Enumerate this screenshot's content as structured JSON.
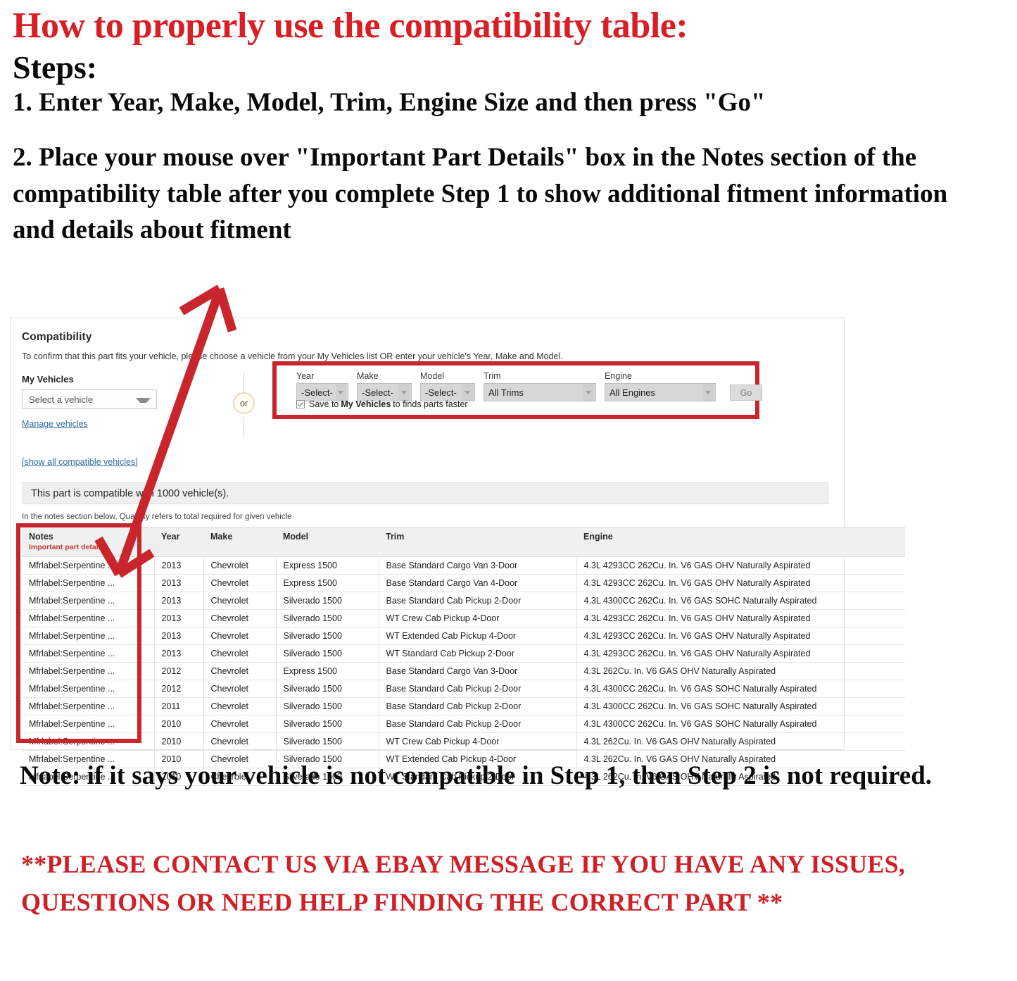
{
  "headline": {
    "title": "How to properly use the compatibility table:",
    "steps_label": "Steps:",
    "step1": "1. Enter Year, Make, Model, Trim, Engine Size and then press \"Go\"",
    "step2": "2. Place your mouse over \"Important Part Details\" box in the Notes section of the compatibility table after you complete Step 1 to show additional fitment information and details about fitment"
  },
  "footer": {
    "note": "Note: if it says your vehicle is not compatible in Step 1, then Step 2 is not required.",
    "contact": "**PLEASE CONTACT US VIA EBAY MESSAGE IF YOU HAVE ANY ISSUES, QUESTIONS OR NEED HELP FINDING THE CORRECT PART **"
  },
  "colors": {
    "red_accent": "#d81f26",
    "annotation_red": "#c8252c",
    "link_blue": "#2d6ca3",
    "important_red": "#c0392b"
  },
  "panel": {
    "title": "Compatibility",
    "subtitle": "To confirm that this part fits your vehicle, please choose a vehicle from your My Vehicles list OR enter your vehicle's Year, Make and Model.",
    "my_vehicles": {
      "label": "My Vehicles",
      "select_value": "Select a vehicle",
      "manage_link": "Manage vehicles"
    },
    "or_label": "or",
    "picker": {
      "fields": [
        {
          "label": "Year",
          "value": "-Select-"
        },
        {
          "label": "Make",
          "value": "-Select-"
        },
        {
          "label": "Model",
          "value": "-Select-"
        },
        {
          "label": "Trim",
          "value": "All Trims"
        },
        {
          "label": "Engine",
          "value": "All Engines"
        }
      ],
      "go_label": "Go",
      "save_prefix": "Save to ",
      "save_bold": "My Vehicles",
      "save_suffix": " to finds parts faster",
      "checkbox_checked": true
    },
    "show_all_link": "[show all compatible vehicles]",
    "compat_banner": "This part is compatible with 1000 vehicle(s).",
    "qty_note": "In the notes section below, Quantity refers to total required for given vehicle",
    "table": {
      "headers": {
        "notes": "Notes",
        "notes_sub": "Important part details",
        "year": "Year",
        "make": "Make",
        "model": "Model",
        "trim": "Trim",
        "engine": "Engine"
      },
      "rows": [
        {
          "notes": "Mfrlabel:Serpentine ...",
          "year": "2013",
          "make": "Chevrolet",
          "model": "Express 1500",
          "trim": "Base Standard Cargo Van 3-Door",
          "engine": "4.3L 4293CC 262Cu. In. V6 GAS OHV Naturally Aspirated"
        },
        {
          "notes": "Mfrlabel:Serpentine ...",
          "year": "2013",
          "make": "Chevrolet",
          "model": "Express 1500",
          "trim": "Base Standard Cargo Van 4-Door",
          "engine": "4.3L 4293CC 262Cu. In. V6 GAS OHV Naturally Aspirated"
        },
        {
          "notes": "Mfrlabel:Serpentine ...",
          "year": "2013",
          "make": "Chevrolet",
          "model": "Silverado 1500",
          "trim": "Base Standard Cab Pickup 2-Door",
          "engine": "4.3L 4300CC 262Cu. In. V6 GAS SOHC Naturally Aspirated"
        },
        {
          "notes": "Mfrlabel:Serpentine ...",
          "year": "2013",
          "make": "Chevrolet",
          "model": "Silverado 1500",
          "trim": "WT Crew Cab Pickup 4-Door",
          "engine": "4.3L 4293CC 262Cu. In. V6 GAS OHV Naturally Aspirated"
        },
        {
          "notes": "Mfrlabel:Serpentine ...",
          "year": "2013",
          "make": "Chevrolet",
          "model": "Silverado 1500",
          "trim": "WT Extended Cab Pickup 4-Door",
          "engine": "4.3L 4293CC 262Cu. In. V6 GAS OHV Naturally Aspirated"
        },
        {
          "notes": "Mfrlabel:Serpentine ...",
          "year": "2013",
          "make": "Chevrolet",
          "model": "Silverado 1500",
          "trim": "WT Standard Cab Pickup 2-Door",
          "engine": "4.3L 4293CC 262Cu. In. V6 GAS OHV Naturally Aspirated"
        },
        {
          "notes": "Mfrlabel:Serpentine ...",
          "year": "2012",
          "make": "Chevrolet",
          "model": "Express 1500",
          "trim": "Base Standard Cargo Van 3-Door",
          "engine": "4.3L 262Cu. In. V6 GAS OHV Naturally Aspirated"
        },
        {
          "notes": "Mfrlabel:Serpentine ...",
          "year": "2012",
          "make": "Chevrolet",
          "model": "Silverado 1500",
          "trim": "Base Standard Cab Pickup 2-Door",
          "engine": "4.3L 4300CC 262Cu. In. V6 GAS SOHC Naturally Aspirated"
        },
        {
          "notes": "Mfrlabel:Serpentine ...",
          "year": "2011",
          "make": "Chevrolet",
          "model": "Silverado 1500",
          "trim": "Base Standard Cab Pickup 2-Door",
          "engine": "4.3L 4300CC 262Cu. In. V6 GAS SOHC Naturally Aspirated"
        },
        {
          "notes": "Mfrlabel:Serpentine ...",
          "year": "2010",
          "make": "Chevrolet",
          "model": "Silverado 1500",
          "trim": "Base Standard Cab Pickup 2-Door",
          "engine": "4.3L 4300CC 262Cu. In. V6 GAS SOHC Naturally Aspirated"
        },
        {
          "notes": "Mfrlabel:Serpentine ...",
          "year": "2010",
          "make": "Chevrolet",
          "model": "Silverado 1500",
          "trim": "WT Crew Cab Pickup 4-Door",
          "engine": "4.3L 262Cu. In. V6 GAS OHV Naturally Aspirated"
        },
        {
          "notes": "Mfrlabel:Serpentine ...",
          "year": "2010",
          "make": "Chevrolet",
          "model": "Silverado 1500",
          "trim": "WT Extended Cab Pickup 4-Door",
          "engine": "4.3L 262Cu. In. V6 GAS OHV Naturally Aspirated"
        },
        {
          "notes": "Mfrlabel:Serpentine ...",
          "year": "2010",
          "make": "Chevrolet",
          "model": "Silverado 1500",
          "trim": "WT Standard Cab Pickup 2-Door",
          "engine": "4.3L 262Cu. In. V6 GAS OHV Naturally Aspirated"
        }
      ]
    }
  }
}
